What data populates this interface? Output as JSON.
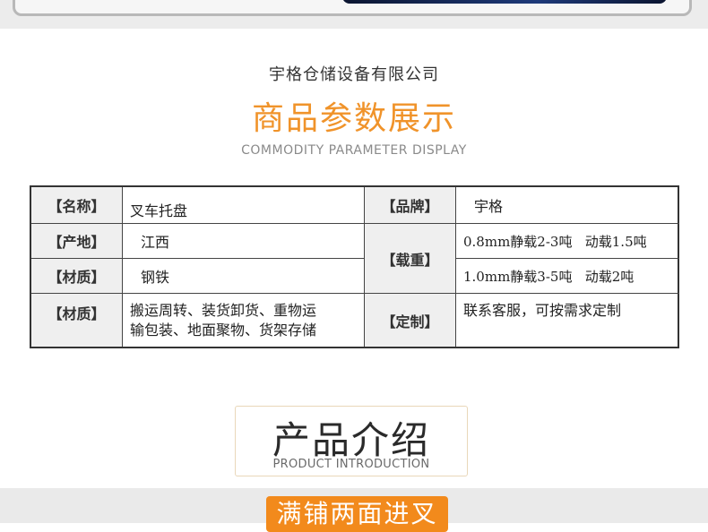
{
  "header": {
    "company": "宇格仓储设备有限公司",
    "title_cn": "商品参数展示",
    "title_en": "COMMODITY PARAMETER DISPLAY"
  },
  "params": {
    "name_label": "【名称】",
    "name_value": "叉车托盘",
    "brand_label": "【品牌】",
    "brand_value": "宇格",
    "origin_label": "【产地】",
    "origin_value": "江西",
    "load_label": "【载重】",
    "load_value_1": "0.8mm静载2-3吨   动载1.5吨",
    "load_value_2": "1.0mm静载3-5吨   动载2吨",
    "material_label": "【材质】",
    "material_value": "钢铁",
    "usage_label": "【材质】",
    "usage_value_line1": "搬运周转、装货卸货、重物运",
    "usage_value_line2": "输包装、地面聚物、货架存储",
    "custom_label": "【定制】",
    "custom_value": "联系客服，可按需求定制"
  },
  "intro": {
    "title_cn": "产品介绍",
    "title_en": "PRODUCT INTRODUCTION"
  },
  "bottom": {
    "badge_text": "满铺两面进叉"
  },
  "colors": {
    "accent_orange": "#f0932a",
    "label_bg": "#efefef",
    "border": "#333333"
  }
}
